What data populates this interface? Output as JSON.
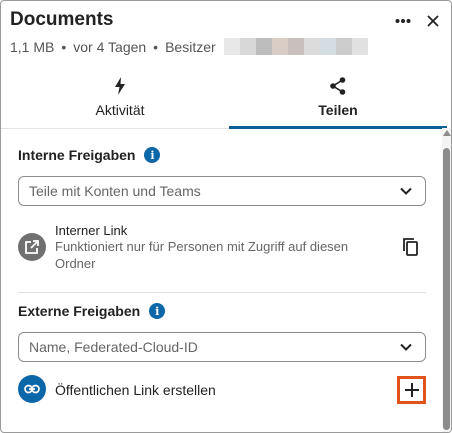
{
  "header": {
    "title": "Documents",
    "size": "1,1 MB",
    "modified": "vor 4 Tagen",
    "owner_label": "Besitzer",
    "owner_blur_colors": [
      "#e8e8e8",
      "#d8d8d8",
      "#bdbdbd",
      "#d9cdc6",
      "#c9c0bd",
      "#dcdcdc",
      "#d3dde2",
      "#cccccc",
      "#e1e1e1"
    ]
  },
  "icons": {
    "menu": "more-horizontal-icon",
    "close": "close-icon",
    "activity": "lightning-icon",
    "share": "share-icon",
    "info": "info-icon",
    "chevron": "chevron-down-icon",
    "internal_link": "open-external-icon",
    "copy": "copy-icon",
    "public_link": "link-icon",
    "add": "plus-icon"
  },
  "tabs": [
    {
      "label": "Aktivität",
      "active": false
    },
    {
      "label": "Teilen",
      "active": true
    }
  ],
  "internal": {
    "title": "Interne Freigaben",
    "info_glyph": "i",
    "select_placeholder": "Teile mit Konten und Teams",
    "link_title": "Interner Link",
    "link_desc": "Funktioniert nur für Personen mit Zugriff auf diesen Ordner"
  },
  "external": {
    "title": "Externe Freigaben",
    "info_glyph": "i",
    "select_placeholder": "Name, Federated-Cloud-ID",
    "public_link_label": "Öffentlichen Link erstellen"
  },
  "colors": {
    "accent": "#0b5e96",
    "info": "#0b67a8",
    "internal_icon_bg": "#707070",
    "public_icon_bg": "#0b67a8",
    "highlight": "#e0531b"
  }
}
